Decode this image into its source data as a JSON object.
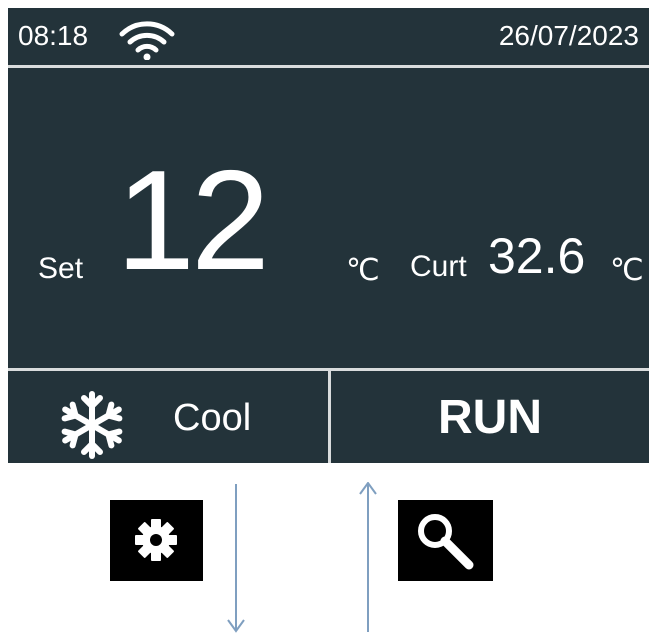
{
  "status_bar": {
    "time": "08:18",
    "wifi_icon": "wifi-icon",
    "date": "26/07/2023"
  },
  "temperature": {
    "set_label": "Set",
    "set_value": "12",
    "set_unit": "℃",
    "current_label": "Curt",
    "current_value": "32.6",
    "current_unit": "℃"
  },
  "mode": {
    "icon": "snowflake-icon",
    "label": "Cool"
  },
  "status": {
    "label": "RUN"
  },
  "controls": {
    "settings_icon": "gear-icon",
    "search_icon": "search-icon",
    "down_arrow_icon": "arrow-down-icon",
    "up_arrow_icon": "arrow-up-icon"
  },
  "colors": {
    "panel_background": "#23333a",
    "divider": "#d9dcdd",
    "text": "#ffffff",
    "button_background": "#000000",
    "arrow": "#7f9fc0"
  }
}
